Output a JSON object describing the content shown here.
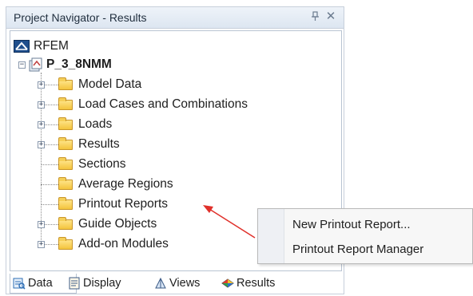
{
  "panel": {
    "title": "Project Navigator - Results",
    "pin_glyph": "ꟷ",
    "close_glyph": "✕"
  },
  "tree": {
    "root_label": "RFEM",
    "project_label": "P_3_8NMM",
    "items": [
      {
        "label": "Model Data",
        "expandable": true
      },
      {
        "label": "Load Cases and Combinations",
        "expandable": true
      },
      {
        "label": "Loads",
        "expandable": true
      },
      {
        "label": "Results",
        "expandable": true
      },
      {
        "label": "Sections",
        "expandable": false
      },
      {
        "label": "Average Regions",
        "expandable": false
      },
      {
        "label": "Printout Reports",
        "expandable": false
      },
      {
        "label": "Guide Objects",
        "expandable": true
      },
      {
        "label": "Add-on Modules",
        "expandable": true
      }
    ]
  },
  "tabs": [
    {
      "label": "Data",
      "icon": "data-icon",
      "active": true
    },
    {
      "label": "Display",
      "icon": "display-icon",
      "active": false
    },
    {
      "label": "Views",
      "icon": "views-icon",
      "active": false
    },
    {
      "label": "Results",
      "icon": "results-icon",
      "active": false
    }
  ],
  "context_menu": {
    "items": [
      "New Printout Report...",
      "Printout Report Manager"
    ]
  },
  "colors": {
    "arrow": "#e0302a",
    "folder": "#f3c43c",
    "title_bar": "#dde6f1"
  }
}
